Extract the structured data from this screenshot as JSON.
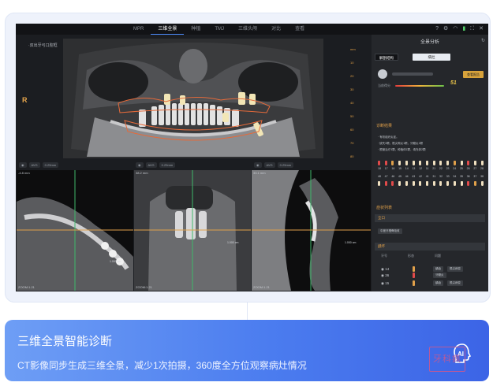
{
  "app": {
    "tabs": [
      "MPR",
      "三维全景",
      "种植",
      "TMJ",
      "三维头颅",
      "对比",
      "查看"
    ],
    "active_tab": "三维全景",
    "pano_label": "·双出牙弓口腔框",
    "side_marker": "R",
    "scale_ticks": [
      "mm",
      "10",
      "20",
      "30",
      "40",
      "50",
      "60",
      "70",
      "80"
    ],
    "views": [
      {
        "label": "-4.8 mm",
        "zoom": "ZOOM:1.21",
        "toolbar": [
          "AVG",
          "0.25mm"
        ],
        "cm": "1.000 cm"
      },
      {
        "label": "38.2 mm",
        "zoom": "ZOOM:1.21",
        "toolbar": [
          "AVG",
          "0.25mm"
        ],
        "cm": "1.000 cm"
      },
      {
        "label": "33.1 mm",
        "zoom": "ZOOM:1.21",
        "toolbar": [
          "AVG",
          "0.25mm"
        ],
        "cm": "1.000 cm"
      }
    ]
  },
  "panel": {
    "title": "全景分析",
    "btn_a": "解剖结构",
    "btn_b": "病灶",
    "score_label": "当前得分",
    "score_value": "51",
    "report_btn": "查看报告",
    "diag_section": "诊断结果",
    "diag_notes": [
      "· 有软组织炎症。",
      "· 缺失3颗，根尖周炎1颗，牙髓炎1颗",
      "· 根管治疗3颗，种植体1颗，填充体2颗"
    ],
    "upper_nums": [
      "18",
      "17",
      "16",
      "15",
      "14",
      "13",
      "12",
      "11",
      "21",
      "22",
      "23",
      "24",
      "25",
      "26",
      "27",
      "28"
    ],
    "lower_nums": [
      "48",
      "47",
      "46",
      "45",
      "44",
      "43",
      "42",
      "41",
      "31",
      "32",
      "33",
      "34",
      "35",
      "36",
      "37",
      "38"
    ],
    "symptom_section": "症状列表",
    "oral_head": "全口",
    "oral_chip": "中度牙槽骨吸收",
    "lesion_head": "龋坏",
    "col_tooth": "牙号",
    "col_shape": "形态",
    "col_issue": "问题",
    "rows": [
      {
        "tooth": "14",
        "tags": [
          "龋齿",
          "根尖病变"
        ]
      },
      {
        "tooth": "15",
        "tags": [
          "龋齿",
          "根尖病变"
        ]
      },
      {
        "tooth": "36",
        "tags": [
          "牙髓炎"
        ]
      }
    ]
  },
  "banner": {
    "title": "三维全景智能诊断",
    "desc": "CT影像同步生成三维全景，减少1次拍摄，360度全方位观察病灶情况",
    "ai": "AI",
    "watermark": "牙科疯"
  },
  "colors": {
    "accent": "#4b7cef",
    "orange": "#e0a04a",
    "panel": "#25272b"
  }
}
